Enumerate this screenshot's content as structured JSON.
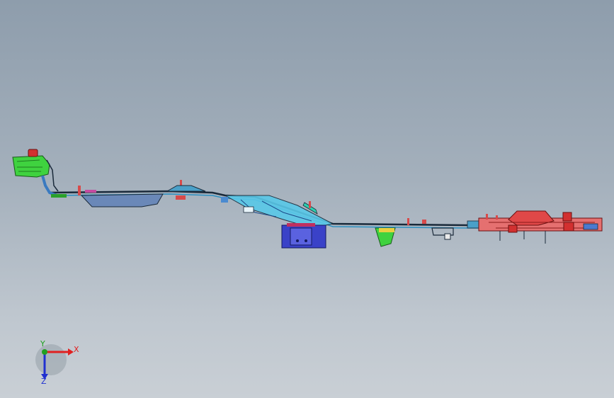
{
  "viewport": {
    "background_top": "#8e9dac",
    "background_bottom": "#c9cfd5"
  },
  "model": {
    "colors": {
      "green_part": "#3fd23f",
      "red_part": "#e04848",
      "cyan_part": "#59c8e8",
      "blue_part": "#3a42c8",
      "edge": "#1a2a3a"
    }
  },
  "triad": {
    "x_label": "X",
    "y_label": "Y",
    "z_label": "Z",
    "x_color": "#e02020",
    "y_color": "#20a020",
    "z_color": "#2030d0"
  }
}
